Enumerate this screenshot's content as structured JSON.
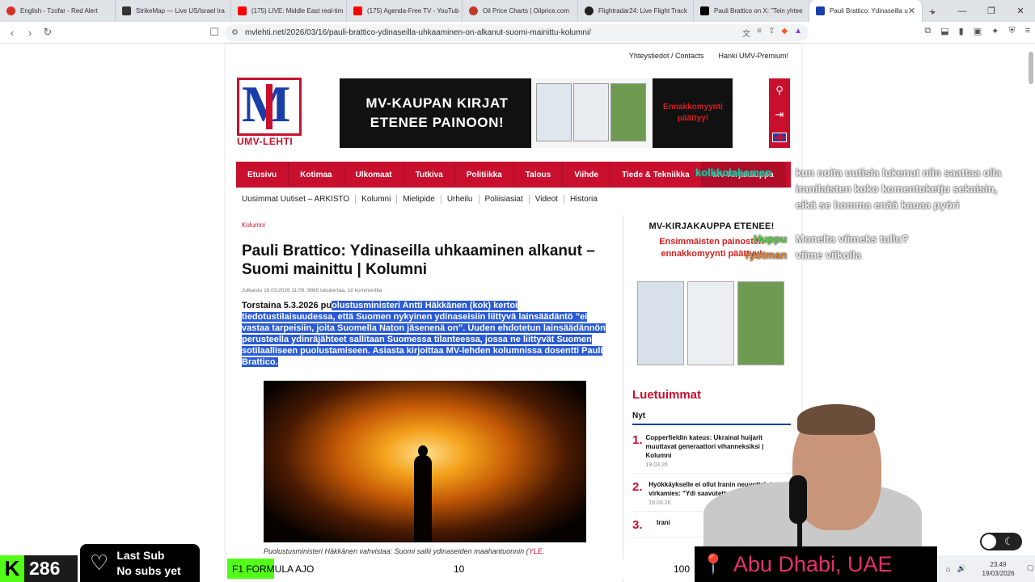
{
  "browser": {
    "tabs": [
      {
        "label": "English - Tzofar - Red Alert",
        "color": "#d93025",
        "active": false
      },
      {
        "label": "StrikeMap — Live US/Israel Ira",
        "color": "#333333",
        "active": false
      },
      {
        "label": "(175) LIVE: Middle East real-tim",
        "color": "#ff0000",
        "active": false
      },
      {
        "label": "(175) Agenda-Free TV - YouTub",
        "color": "#ff0000",
        "active": false
      },
      {
        "label": "Oil Price Charts | Oilprice.com",
        "color": "#c0392b",
        "active": false
      },
      {
        "label": "Flightradar24: Live Flight Track",
        "color": "#222222",
        "active": false
      },
      {
        "label": "Pauli Brattico on X: \"Tein yhtee",
        "color": "#000000",
        "active": false
      },
      {
        "label": "Pauli Brattico: Ydinaseilla u",
        "color": "#1a3ea8",
        "active": true
      }
    ],
    "url": "mvlehti.net/2026/03/16/pauli-brattico-ydinaseilla-uhkaaminen-on-alkanut-suomi-mainittu-kolumni/"
  },
  "site": {
    "toplinks": [
      "Yhteystiedot / Contacts",
      "Hanki UMV-Premium!"
    ],
    "logo_text": "UMV-LEHTI",
    "banner": {
      "line1": "MV-KAUPAN KIRJAT",
      "line2": "ETENEE PAINOON!",
      "right1": "Ennakkomyynti",
      "right2": "päättyy!"
    },
    "mainnav": [
      "Etusivu",
      "Kotimaa",
      "Ulkomaat",
      "Tutkiva",
      "Politiikka",
      "Talous",
      "Viihde",
      "Tiede & Tekniikka",
      "MV-Kirjakauppa"
    ],
    "subnav": [
      "Uusimmat Uutiset – ARKISTO",
      "Kolumni",
      "Mielipide",
      "Urheilu",
      "Poliisiasiat",
      "Videot",
      "Historia"
    ]
  },
  "article": {
    "category": "Kolumni",
    "title": "Pauli Brattico: Ydinaseilla uhkaaminen alkanut – Suomi mainittu | Kolumni",
    "meta": "Julkaistu 16.03.2026 11:09, 9885 lukukertaa, 18 kommenttia",
    "lead_plain": "Torstaina 5.3.2026 pu",
    "lead_selected": "olustusministeri Antti Häkkänen (kok) kertoi tiedotustilaisuudessa, että Suomen nykyinen ydinaseisiin liittyvä lainsäädäntö ”ei vastaa tarpeisiin, joita Suomella Naton jäsenenä on”. Uuden ehdotetun lainsäädännön perusteella ydinräjähteet sallitaan Suomessa tilanteessa, jossa ne liittyvät Suomen sotilaalliseen puolustamiseen. Asiasta kirjoittaa MV-lehden kolumnissa dosentti Pauli Brattico.",
    "caption": "Puolustusministeri Häkkänen vahvistaa: Suomi sallii ydinaseiden maahantuonnin (",
    "caption_link": "YLE,"
  },
  "aside": {
    "promo_title": "MV-KIRJAKAUPPA ETENEE!",
    "promo_sub1": "Ensimmäisten painosten",
    "promo_sub2": "ennakkomyynti päättyy!",
    "popular_title": "Luetuimmat",
    "tab_now": "Nyt",
    "items": [
      {
        "num": "1.",
        "title": "Copperfieldin kateus: Ukrainal huijarit muuttavat generaattori vihanneksiksi | Kolumni",
        "date": "19.03.26"
      },
      {
        "num": "2.",
        "title": "Hyökkäykselle ei ollut Iranin neuvottelui virkamies: \"Ydi saavutettavi",
        "date": "19.03.26"
      },
      {
        "num": "3.",
        "title": "Irani",
        "date": ""
      }
    ]
  },
  "chat": [
    {
      "name": "kolkkolakomen",
      "text": "kun noita uutisia lukenut niin saattaa olla iranilaisten koko komentoketju sekaisin, eikä se homma enää kauaa pyöri"
    },
    {
      "name": "Huppu",
      "text": "Monelta viimeks tullu?"
    },
    {
      "name": "ryotman",
      "text": "viime viikolla"
    }
  ],
  "stream": {
    "viewer_count": "286",
    "last_sub_label": "Last Sub",
    "last_sub_value": "No subs yet",
    "ticker_label": "F1 FORMULA AJO",
    "ticker_mid": "10",
    "ticker_right": "100",
    "location": "Abu Dhabi, UAE"
  },
  "taskbar": {
    "time": "23.49",
    "date": "19/03/2026"
  },
  "colors": {
    "brand_red": "#c8102e",
    "brand_blue": "#1a3ea8",
    "kick_green": "#53fc18",
    "selection": "#2a5bd7"
  }
}
